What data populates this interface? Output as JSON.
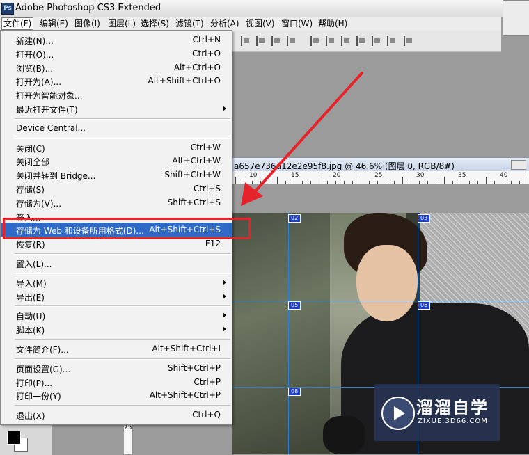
{
  "app": {
    "title": "Adobe Photoshop CS3 Extended",
    "logo_text": "Ps"
  },
  "menubar": [
    {
      "label": "文件(F)",
      "active": true
    },
    {
      "label": "编辑(E)"
    },
    {
      "label": "图像(I)"
    },
    {
      "label": "图层(L)"
    },
    {
      "label": "选择(S)"
    },
    {
      "label": "滤镜(T)"
    },
    {
      "label": "分析(A)"
    },
    {
      "label": "视图(V)"
    },
    {
      "label": "窗口(W)"
    },
    {
      "label": "帮助(H)"
    }
  ],
  "document": {
    "tab_title": "a657e736d12e2e95f8.jpg @ 46.6% (图层 0, RGB/8#)"
  },
  "ruler": {
    "labels": [
      "10",
      "15",
      "20",
      "25",
      "30",
      "35",
      "40"
    ],
    "left_label": "25"
  },
  "file_menu": {
    "items": [
      {
        "label": "新建(N)...",
        "shortcut": "Ctrl+N"
      },
      {
        "label": "打开(O)...",
        "shortcut": "Ctrl+O"
      },
      {
        "label": "浏览(B)...",
        "shortcut": "Alt+Ctrl+O"
      },
      {
        "label": "打开为(A)...",
        "shortcut": "Alt+Shift+Ctrl+O"
      },
      {
        "label": "打开为智能对象...",
        "shortcut": ""
      },
      {
        "label": "最近打开文件(T)",
        "shortcut": "",
        "submenu": true
      },
      {
        "separator": true
      },
      {
        "label": "Device Central...",
        "shortcut": ""
      },
      {
        "separator": true
      },
      {
        "label": "关闭(C)",
        "shortcut": "Ctrl+W"
      },
      {
        "label": "关闭全部",
        "shortcut": "Alt+Ctrl+W"
      },
      {
        "label": "关闭并转到 Bridge...",
        "shortcut": "Shift+Ctrl+W"
      },
      {
        "label": "存储(S)",
        "shortcut": "Ctrl+S"
      },
      {
        "label": "存储为(V)...",
        "shortcut": "Shift+Ctrl+S"
      },
      {
        "label": "签入...",
        "shortcut": ""
      },
      {
        "label": "存储为 Web 和设备所用格式(D)...",
        "shortcut": "Alt+Shift+Ctrl+S",
        "highlighted": true
      },
      {
        "label": "恢复(R)",
        "shortcut": "F12"
      },
      {
        "separator": true
      },
      {
        "label": "置入(L)...",
        "shortcut": ""
      },
      {
        "separator": true
      },
      {
        "label": "导入(M)",
        "shortcut": "",
        "submenu": true
      },
      {
        "label": "导出(E)",
        "shortcut": "",
        "submenu": true
      },
      {
        "separator": true
      },
      {
        "label": "自动(U)",
        "shortcut": "",
        "submenu": true
      },
      {
        "label": "脚本(K)",
        "shortcut": "",
        "submenu": true
      },
      {
        "separator": true
      },
      {
        "label": "文件简介(F)...",
        "shortcut": "Alt+Shift+Ctrl+I"
      },
      {
        "separator": true
      },
      {
        "label": "页面设置(G)...",
        "shortcut": "Shift+Ctrl+P"
      },
      {
        "label": "打印(P)...",
        "shortcut": "Ctrl+P"
      },
      {
        "label": "打印一份(Y)",
        "shortcut": "Alt+Shift+Ctrl+P"
      },
      {
        "separator": true
      },
      {
        "label": "退出(X)",
        "shortcut": "Ctrl+Q"
      }
    ]
  },
  "slices": [
    "02",
    "03",
    "05",
    "06",
    "08"
  ],
  "watermark": {
    "title": "溜溜自学",
    "subtitle": "ZIXUE.3D66.COM"
  },
  "colors": {
    "highlight": "#2f6bc6",
    "annotation_red": "#e6232a",
    "guide_blue": "#2f7fd8"
  }
}
